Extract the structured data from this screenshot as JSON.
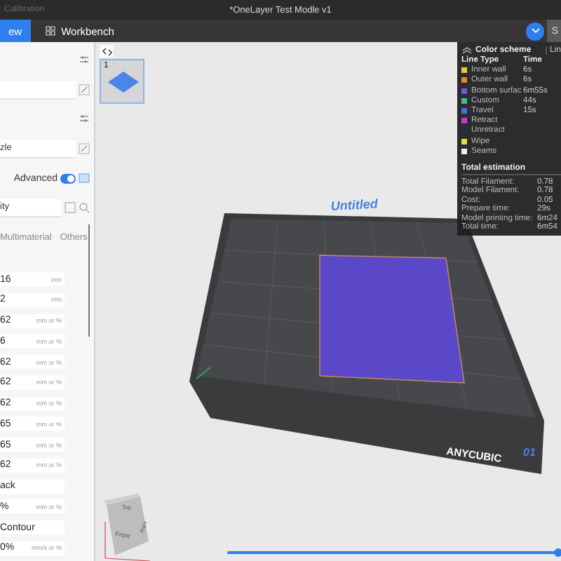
{
  "title_bar": {
    "app": "Calibration",
    "document": "*OneLayer Test Modle v1"
  },
  "toolbar": {
    "tabs": [
      {
        "label": "ew",
        "selected": true
      },
      {
        "label": "Workbench",
        "selected": false
      }
    ],
    "side_button": "S"
  },
  "left_panel": {
    "rows": [
      {
        "kind": "settings-row"
      },
      {
        "kind": "empty-field"
      },
      {
        "kind": "settings-row"
      },
      {
        "kind": "edit-field",
        "value": "zle"
      },
      {
        "kind": "toggle",
        "label": "Advanced",
        "on": true
      },
      {
        "kind": "search-field",
        "value": "ity"
      },
      {
        "kind": "tabs",
        "tabs": [
          {
            "label": "Multimaterial",
            "selected": false
          },
          {
            "label": "Others",
            "selected": false
          }
        ]
      }
    ],
    "values": [
      {
        "value": "16",
        "unit": "mm"
      },
      {
        "value": "2",
        "unit": "mm"
      },
      {
        "value": "62",
        "unit": "mm or %"
      },
      {
        "value": "6",
        "unit": "mm or %"
      },
      {
        "value": "62",
        "unit": "mm or %"
      },
      {
        "value": "62",
        "unit": "mm or %"
      },
      {
        "value": "62",
        "unit": "mm or %"
      },
      {
        "value": "65",
        "unit": "mm or %"
      },
      {
        "value": "65",
        "unit": "mm or %"
      },
      {
        "value": "62",
        "unit": "mm or %"
      },
      {
        "value": "ack"
      },
      {
        "value": "%",
        "unit": "mm or %"
      },
      {
        "value": "Contour"
      },
      {
        "value": "0%",
        "unit": "mm/s or %"
      }
    ]
  },
  "viewport": {
    "plate_number": "1",
    "bed_name": "Untitled",
    "bed_brand": "ANYCUBIC",
    "bed_index": "01",
    "view_cube": {
      "top": "Top",
      "front": "Front",
      "right": "Right"
    },
    "layer_slider": {
      "level": 1
    }
  },
  "legend": {
    "title": "Color scheme",
    "dropdown": "Lin",
    "columns": [
      "Line Type",
      "Time"
    ],
    "items": [
      {
        "name": "Inner wall",
        "time": "6s",
        "color": "#e6cf3c"
      },
      {
        "name": "Outer wall",
        "time": "6s",
        "color": "#e5833a"
      },
      {
        "name": "Bottom surfac",
        "time": "6m55s",
        "color": "#6a5fd0"
      },
      {
        "name": "Custom",
        "time": "44s",
        "color": "#3cc096"
      },
      {
        "name": "Travel",
        "time": "15s",
        "color": "#4a6fe0"
      },
      {
        "name": "Retract",
        "color": "#c63ad4"
      },
      {
        "name": "Unretract",
        "color": "#2e2e3a"
      },
      {
        "name": "Wipe",
        "color": "#e8e03a"
      },
      {
        "name": "Seams",
        "color": "#f2f2f2"
      }
    ],
    "estimation_title": "Total estimation",
    "estimation": [
      {
        "label": "Total Filament:",
        "value": "0.78"
      },
      {
        "label": "Model Filament:",
        "value": "0.78"
      },
      {
        "label": "Cost:",
        "value": "0.05"
      },
      {
        "label": "Prepare time:",
        "value": "29s"
      },
      {
        "label": "Model printing time:",
        "value": "6m24"
      },
      {
        "label": "Total time:",
        "value": "6m54"
      }
    ]
  }
}
